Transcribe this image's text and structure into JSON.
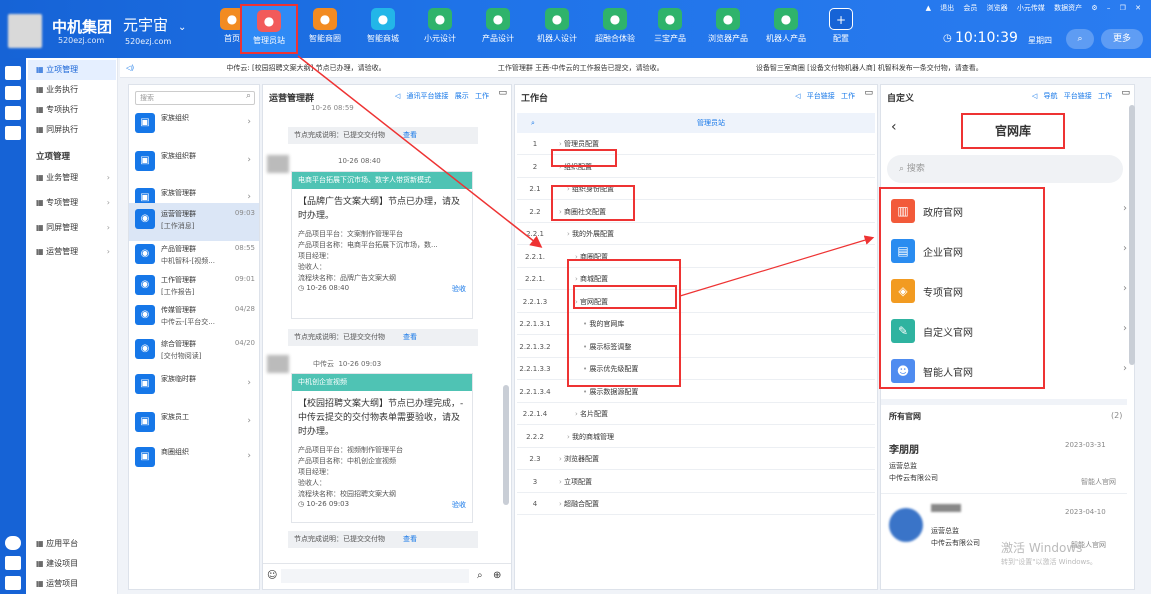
{
  "header": {
    "brand": "中机集团",
    "site": "520ezj.com",
    "platform": "元宇宙",
    "nav": [
      {
        "label": "首页",
        "icon": "house-icon",
        "color": "#f28b21"
      },
      {
        "label": "管理员站",
        "icon": "monitor-icon",
        "color": "#f25a5a"
      },
      {
        "label": "智能商圈",
        "icon": "target-icon",
        "color": "#f28b21"
      },
      {
        "label": "智能商城",
        "icon": "cart-icon",
        "color": "#23b6e8"
      },
      {
        "label": "小元设计",
        "icon": "robot-icon",
        "color": "#2fb36b"
      },
      {
        "label": "产品设计",
        "icon": "robot-icon",
        "color": "#2fb36b"
      },
      {
        "label": "机器人设计",
        "icon": "robot-icon",
        "color": "#2fb36b"
      },
      {
        "label": "超融合体验",
        "icon": "robot-icon",
        "color": "#2fb36b"
      },
      {
        "label": "三宝产品",
        "icon": "robot-icon",
        "color": "#2fb36b"
      },
      {
        "label": "浏览器产品",
        "icon": "swirl-icon",
        "color": "#2fb36b"
      },
      {
        "label": "机器人产品",
        "icon": "robot-icon",
        "color": "#2fb36b"
      },
      {
        "label": "配置",
        "icon": "plus-icon",
        "color": "#1663d6"
      }
    ],
    "links": [
      "退出",
      "会员",
      "浏览器",
      "小元传媒",
      "数据资产"
    ],
    "time": "10:10:39",
    "weekday": "星期四",
    "more": "更多"
  },
  "notices": [
    "中传云: [校园招聘文案大纲] 节点已办理，请验收。",
    "工作管理群 王茜-中传云的工作报告已提交，请验收。",
    "设备智三室商圈 [设备文付物机器人商] 机智科发布一条交付物，请查看。"
  ],
  "sidebar": {
    "items": [
      "立项管理",
      "业务执行",
      "专项执行",
      "同屏执行"
    ],
    "section": "立项管理",
    "sub": [
      "业务管理",
      "专项管理",
      "同屏管理",
      "运营管理"
    ],
    "bottom": [
      "应用平台",
      "建设项目",
      "运营项目"
    ]
  },
  "orgs": {
    "search_placeholder": "搜索",
    "items": [
      {
        "name": "家族组织",
        "sub": "",
        "time": ""
      },
      {
        "name": "家族组织群",
        "sub": "",
        "time": ""
      },
      {
        "name": "家族管理群",
        "sub": "",
        "time": ""
      },
      {
        "name": "运营管理群",
        "sub": "[工作消息]",
        "time": "09:03"
      },
      {
        "name": "产品管理群",
        "sub": "中机智科-[视频...",
        "time": "08:55"
      },
      {
        "name": "工作管理群",
        "sub": "[工作报告]",
        "time": "09:01"
      },
      {
        "name": "传媒管理群",
        "sub": "中传云-[平台交...",
        "time": "04/28"
      },
      {
        "name": "综合管理群",
        "sub": "[交付物阅读]",
        "time": "04/20"
      },
      {
        "name": "家族临时群",
        "sub": "",
        "time": ""
      },
      {
        "name": "家族员工",
        "sub": "",
        "time": ""
      },
      {
        "name": "商圈组织",
        "sub": "",
        "time": ""
      }
    ]
  },
  "chat": {
    "title": "运营管理群",
    "tools": [
      "通讯平台链接",
      "展示",
      "工作"
    ],
    "time_top": "10-26 08:59",
    "note_text": "节点完成说明：已提交交付物",
    "note_link": "查看",
    "msg1": {
      "time": "10-26 08:40",
      "head": "电商平台拓展下沉市场、数字人带货新模式",
      "body": "【品牌广告文案大纲】节点已办理，请及时办理。",
      "lines": [
        "产品项目平台：文案制作管理平台",
        "产品项目名称：电商平台拓展下沉市场，数...",
        "项目经理：",
        "验收人：",
        "流程块名称：品牌广告文案大纲"
      ],
      "action": "验收"
    },
    "msg2": {
      "sender": "中传云",
      "time": "10-26 09:03",
      "head": "中机创企宣视频",
      "body": "【校园招聘文案大纲】节点已办理完成，-中传云提交的交付物表单需要验收，请及时办理。",
      "lines": [
        "产品项目平台：视频制作管理平台",
        "产品项目名称：中机创企宣视频",
        "项目经理：",
        "验收人：",
        "流程块名称：校园招聘文案大纲"
      ],
      "action": "验收"
    }
  },
  "workbench": {
    "title": "工作台",
    "tools": [
      "平台链接",
      "工作"
    ],
    "column": "管理员站",
    "rows": [
      {
        "no": "1",
        "text": "管理员配置",
        "indent": 0
      },
      {
        "no": "2",
        "text": "组织配置",
        "indent": 0
      },
      {
        "no": "2.1",
        "text": "组织身份配置",
        "indent": 1
      },
      {
        "no": "2.2",
        "text": "商圈社交配置",
        "indent": 0
      },
      {
        "no": "2.2.1",
        "text": "我的外展配置",
        "indent": 1
      },
      {
        "no": "2.2.1.",
        "text": "商圈配置",
        "indent": 2
      },
      {
        "no": "2.2.1.",
        "text": "商城配置",
        "indent": 2
      },
      {
        "no": "2.2.1.3",
        "text": "官网配置",
        "indent": 2
      },
      {
        "no": "2.2.1.3.1",
        "text": "我的官网库",
        "indent": 3
      },
      {
        "no": "2.2.1.3.2",
        "text": "展示标签调整",
        "indent": 3
      },
      {
        "no": "2.2.1.3.3",
        "text": "展示优先级配置",
        "indent": 3
      },
      {
        "no": "2.2.1.3.4",
        "text": "展示数据源配置",
        "indent": 3
      },
      {
        "no": "2.2.1.4",
        "text": "名片配置",
        "indent": 2
      },
      {
        "no": "2.2.2",
        "text": "我的商城管理",
        "indent": 1
      },
      {
        "no": "2.3",
        "text": "浏览器配置",
        "indent": 0
      },
      {
        "no": "3",
        "text": "立项配置",
        "indent": 0
      },
      {
        "no": "4",
        "text": "超融合配置",
        "indent": 0
      }
    ]
  },
  "custom": {
    "title": "自定义",
    "tools": [
      "导航",
      "平台链接",
      "工作"
    ],
    "library_title": "官网库",
    "search_placeholder": "搜索",
    "items": [
      {
        "label": "政府官网",
        "color": "#f25a3a",
        "icon": "building-icon"
      },
      {
        "label": "企业官网",
        "color": "#2a8cf0",
        "icon": "office-icon"
      },
      {
        "label": "专项官网",
        "color": "#f29b21",
        "icon": "layers-icon"
      },
      {
        "label": "自定义官网",
        "color": "#2fb3a0",
        "icon": "edit-icon"
      },
      {
        "label": "智能人官网",
        "color": "#4f8cf0",
        "icon": "person-icon"
      }
    ],
    "all_label": "所有官网",
    "all_count": "(2)",
    "people": [
      {
        "name": "李朋朋",
        "role": "运营总监",
        "company": "中传云有限公司",
        "date": "2023-03-31",
        "tag": "智能人官网"
      },
      {
        "name": "",
        "role": "运营总监",
        "company": "中传云有限公司",
        "date": "2023-04-10",
        "tag": "智能人官网"
      }
    ],
    "watermark1": "激活 Windows",
    "watermark2": "转到\"设置\"以激活 Windows。"
  }
}
